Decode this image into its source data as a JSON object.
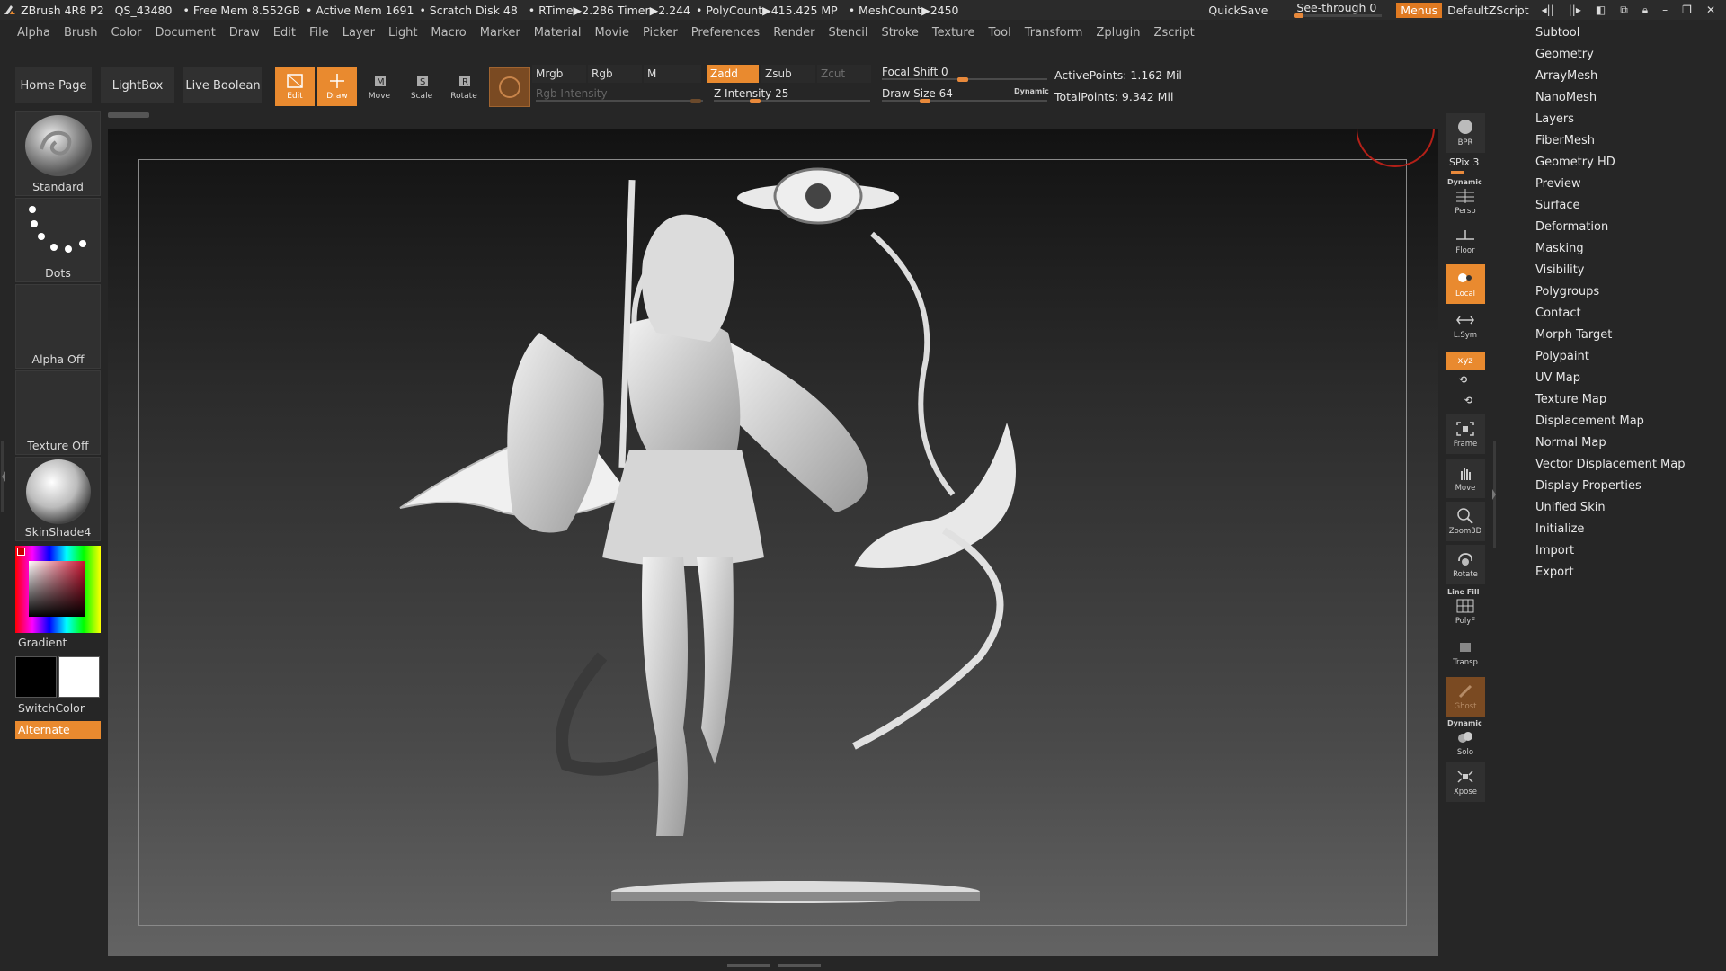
{
  "titlebar": {
    "app": "ZBrush 4R8 P2",
    "project": "QS_43480",
    "free_mem": "• Free Mem 8.552GB",
    "active_mem": "• Active Mem 1691",
    "scratch": "• Scratch Disk 48",
    "rtime": "• RTime▶2.286 Timer▶2.244",
    "polycount": "• PolyCount▶415.425 MP",
    "meshcount": "• MeshCount▶2450",
    "quicksave": "QuickSave",
    "seethrough": "See-through  0",
    "seethrough_value": 0,
    "menus": "Menus",
    "script": "DefaultZScript"
  },
  "menubar": [
    "Alpha",
    "Brush",
    "Color",
    "Document",
    "Draw",
    "Edit",
    "File",
    "Layer",
    "Light",
    "Macro",
    "Marker",
    "Material",
    "Movie",
    "Picker",
    "Preferences",
    "Render",
    "Stencil",
    "Stroke",
    "Texture",
    "Tool",
    "Transform",
    "Zplugin",
    "Zscript"
  ],
  "toolbar": {
    "home": "Home Page",
    "lightbox": "LightBox",
    "liveboolean": "Live Boolean",
    "edit": "Edit",
    "draw": "Draw",
    "move": "Move",
    "scale": "Scale",
    "rotate": "Rotate",
    "mrgb": "Mrgb",
    "rgb": "Rgb",
    "m": "M",
    "zadd": "Zadd",
    "zsub": "Zsub",
    "zcut": "Zcut",
    "rgb_intensity": "Rgb Intensity",
    "z_intensity": "Z Intensity 25",
    "z_intensity_value": 25,
    "focal_shift": "Focal Shift 0",
    "focal_shift_value": 0,
    "draw_size": "Draw Size 64",
    "draw_size_value": 64,
    "dynamic": "Dynamic",
    "active_points": "ActivePoints: 1.162 Mil",
    "total_points": "TotalPoints: 9.342 Mil"
  },
  "leftshelf": {
    "brush": "Standard",
    "stroke": "Dots",
    "alpha": "Alpha Off",
    "texture": "Texture Off",
    "material": "SkinShade4",
    "gradient": "Gradient",
    "switchcolor": "SwitchColor",
    "alternate": "Alternate",
    "main_color": "#000000",
    "secondary_color": "#ffffff"
  },
  "rightshelf": {
    "bpr": "BPR",
    "spix": "SPix 3",
    "dynamic": "Dynamic",
    "persp": "Persp",
    "floor": "Floor",
    "local": "Local",
    "lsym": "L.Sym",
    "xyz": "xyz",
    "frame": "Frame",
    "move": "Move",
    "zoom3d": "Zoom3D",
    "rotate": "Rotate",
    "linefill": "Line Fill",
    "polyf": "PolyF",
    "transp": "Transp",
    "ghost": "Ghost",
    "dynamic2": "Dynamic",
    "solo": "Solo",
    "xpose": "Xpose"
  },
  "palette": [
    "Subtool",
    "Geometry",
    "ArrayMesh",
    "NanoMesh",
    "Layers",
    "FiberMesh",
    "Geometry HD",
    "Preview",
    "Surface",
    "Deformation",
    "Masking",
    "Visibility",
    "Polygroups",
    "Contact",
    "Morph Target",
    "Polypaint",
    "UV Map",
    "Texture Map",
    "Displacement Map",
    "Normal Map",
    "Vector Displacement Map",
    "Display Properties",
    "Unified Skin",
    "Initialize",
    "Import",
    "Export"
  ],
  "colors": {
    "accent": "#e98a2f",
    "background": "#262626",
    "panel": "#303030"
  }
}
